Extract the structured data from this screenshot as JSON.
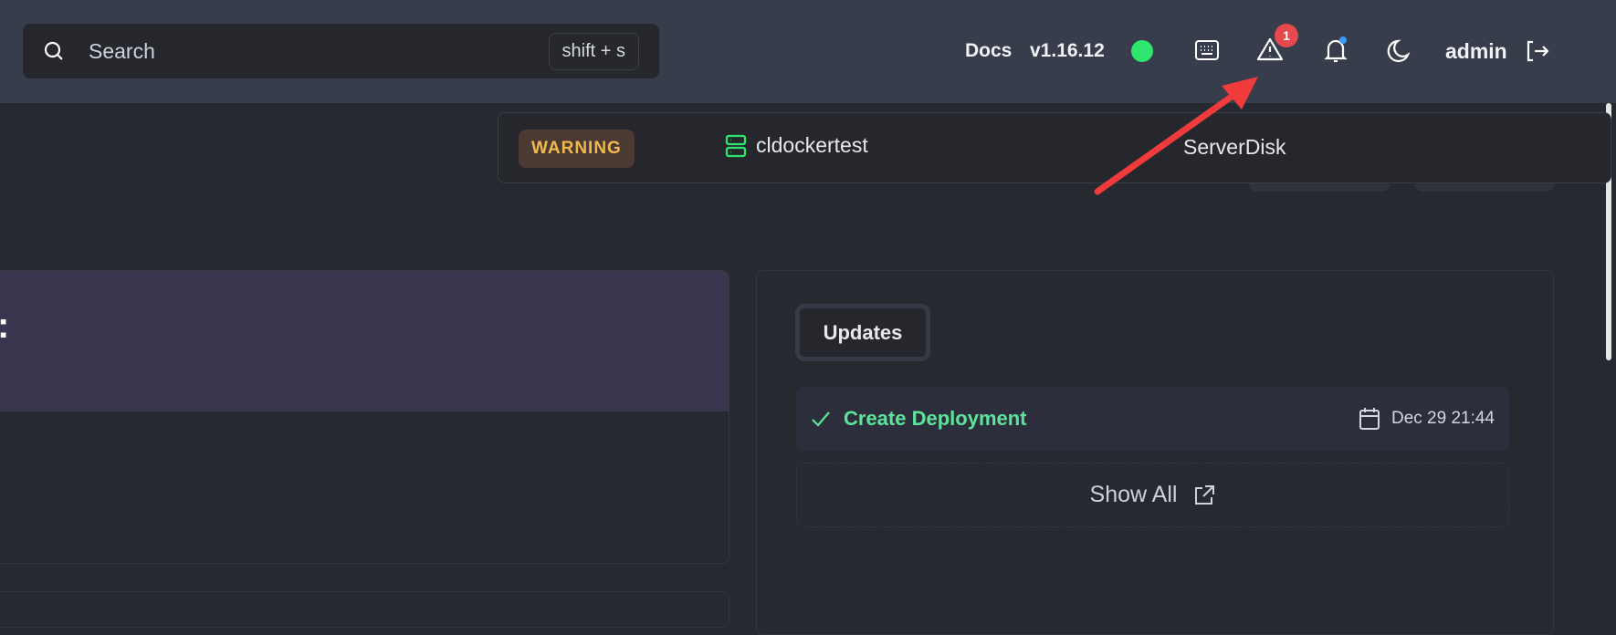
{
  "topbar": {
    "search_placeholder": "Search",
    "search_shortcut": "shift + s",
    "docs_label": "Docs",
    "version": "v1.16.12",
    "alerts_count": "1",
    "user": "admin",
    "colors": {
      "status_online": "#2ee56e",
      "alert_badge": "#e5484d",
      "notification_dot": "#3b9cf5"
    }
  },
  "alert_popup": {
    "severity": "WARNING",
    "server": "cldockertest",
    "alert_type": "ServerDisk"
  },
  "left_card": {
    "header_fragment": ":"
  },
  "updates": {
    "tab_label": "Updates",
    "items": [
      {
        "title": "Create Deployment",
        "status": "success",
        "time": "Dec 29 21:44"
      }
    ],
    "show_all_label": "Show All"
  }
}
